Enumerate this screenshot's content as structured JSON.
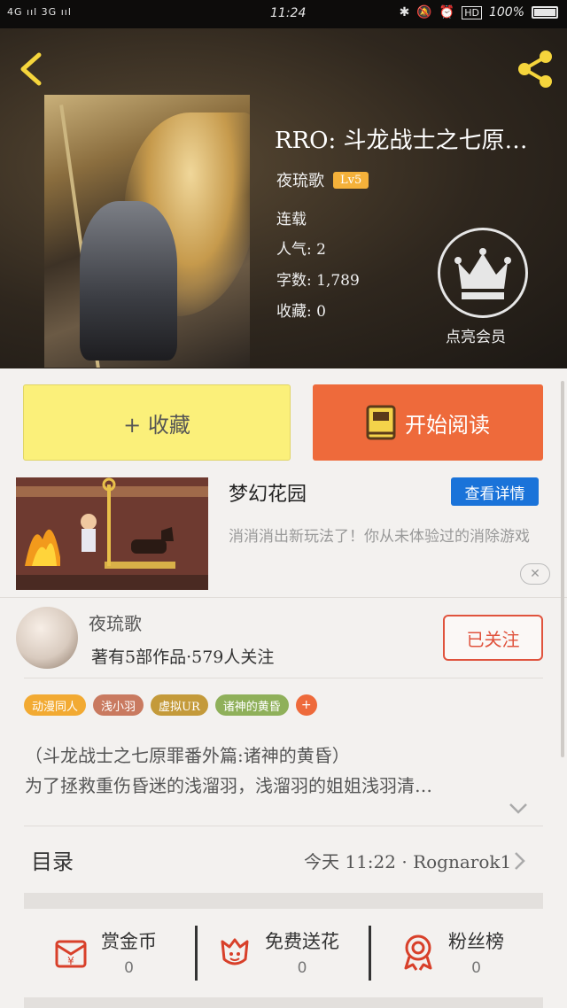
{
  "status_bar": {
    "network": "4G ııl 3G ııl",
    "time": "11:24",
    "icons": [
      "bluetooth-icon",
      "mute-icon",
      "alarm-icon",
      "hd-icon"
    ],
    "hd": "HD",
    "battery": "100%"
  },
  "header": {
    "back_icon": "chevron-left-icon",
    "share_icon": "share-icon"
  },
  "book": {
    "title": "RRO: 斗龙战士之七原…",
    "author": "夜琉歌",
    "level": "Lv5",
    "status": "连载",
    "popularity": "人气: 2",
    "word_count": "字数: 1,789",
    "favorites": "收藏: 0"
  },
  "vip": {
    "label": "点亮会员",
    "icon": "crown-icon"
  },
  "actions": {
    "favorite": "+ 收藏",
    "read": "开始阅读"
  },
  "ad": {
    "title": "梦幻花园",
    "detail_button": "查看详情",
    "description": "消消消出新玩法了！你从未体验过的消除游戏",
    "close_icon": "close-icon"
  },
  "author_card": {
    "name": "夜琉歌",
    "stats": "著有5部作品·579人关注",
    "follow_button": "已关注"
  },
  "tags": [
    {
      "label": "动漫同人",
      "color": "#f2aa32"
    },
    {
      "label": "浅小羽",
      "color": "#c97a60"
    },
    {
      "label": "虚拟UR",
      "color": "#c49a3a"
    },
    {
      "label": "诸神的黄昏",
      "color": "#8fb05a"
    }
  ],
  "synopsis": {
    "line1": "（斗龙战士之七原罪番外篇:诸神的黄昏）",
    "line2": "为了拯救重伤昏迷的浅溜羽，浅溜羽的姐姐浅羽清…"
  },
  "toc": {
    "label": "目录",
    "latest": "今天 11:22 · Rognarok1"
  },
  "bottom_bar": [
    {
      "label": "赏金币",
      "count": "0",
      "icon": "red-envelope-icon"
    },
    {
      "label": "免费送花",
      "count": "0",
      "icon": "flower-icon"
    },
    {
      "label": "粉丝榜",
      "count": "0",
      "icon": "ribbon-badge-icon"
    }
  ],
  "colors": {
    "accent_orange": "#ee6a3b",
    "favorite_yellow": "#fbf07a",
    "follow_red": "#e0533d",
    "ad_blue": "#1a73d9",
    "back_icon_yellow": "#f5d53c"
  }
}
